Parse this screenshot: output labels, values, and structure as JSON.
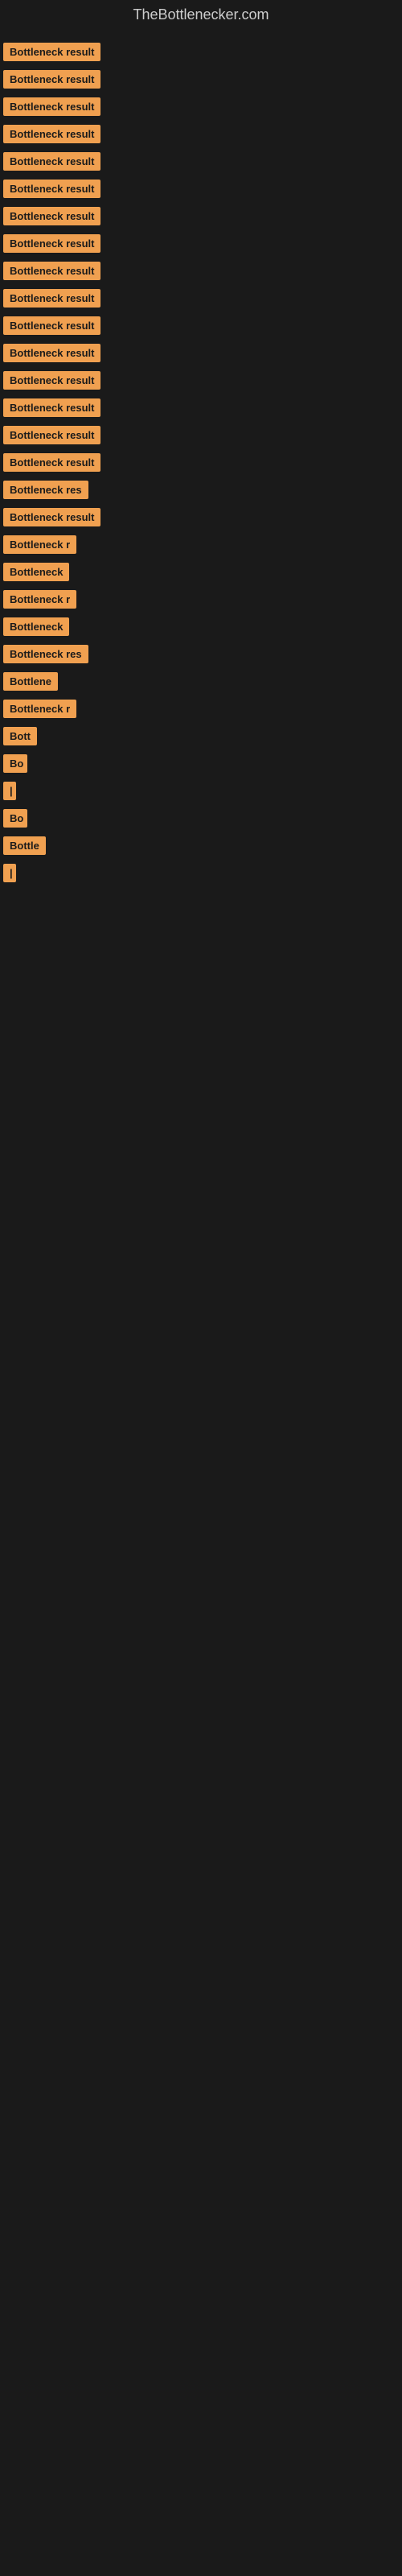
{
  "site": {
    "title": "TheBottlenecker.com"
  },
  "items": [
    {
      "label": "Bottleneck result",
      "width": 160
    },
    {
      "label": "Bottleneck result",
      "width": 160
    },
    {
      "label": "Bottleneck result",
      "width": 155
    },
    {
      "label": "Bottleneck result",
      "width": 155
    },
    {
      "label": "Bottleneck result",
      "width": 155
    },
    {
      "label": "Bottleneck result",
      "width": 150
    },
    {
      "label": "Bottleneck result",
      "width": 150
    },
    {
      "label": "Bottleneck result",
      "width": 148
    },
    {
      "label": "Bottleneck result",
      "width": 148
    },
    {
      "label": "Bottleneck result",
      "width": 145
    },
    {
      "label": "Bottleneck result",
      "width": 145
    },
    {
      "label": "Bottleneck result",
      "width": 140
    },
    {
      "label": "Bottleneck result",
      "width": 138
    },
    {
      "label": "Bottleneck result",
      "width": 135
    },
    {
      "label": "Bottleneck result",
      "width": 133
    },
    {
      "label": "Bottleneck result",
      "width": 130
    },
    {
      "label": "Bottleneck res",
      "width": 120
    },
    {
      "label": "Bottleneck result",
      "width": 128
    },
    {
      "label": "Bottleneck r",
      "width": 105
    },
    {
      "label": "Bottleneck",
      "width": 90
    },
    {
      "label": "Bottleneck r",
      "width": 100
    },
    {
      "label": "Bottleneck",
      "width": 88
    },
    {
      "label": "Bottleneck res",
      "width": 118
    },
    {
      "label": "Bottlene",
      "width": 80
    },
    {
      "label": "Bottleneck r",
      "width": 102
    },
    {
      "label": "Bott",
      "width": 50
    },
    {
      "label": "Bo",
      "width": 30
    },
    {
      "label": "|",
      "width": 10
    },
    {
      "label": "Bo",
      "width": 30
    },
    {
      "label": "Bottle",
      "width": 55
    },
    {
      "label": "|",
      "width": 10
    }
  ]
}
